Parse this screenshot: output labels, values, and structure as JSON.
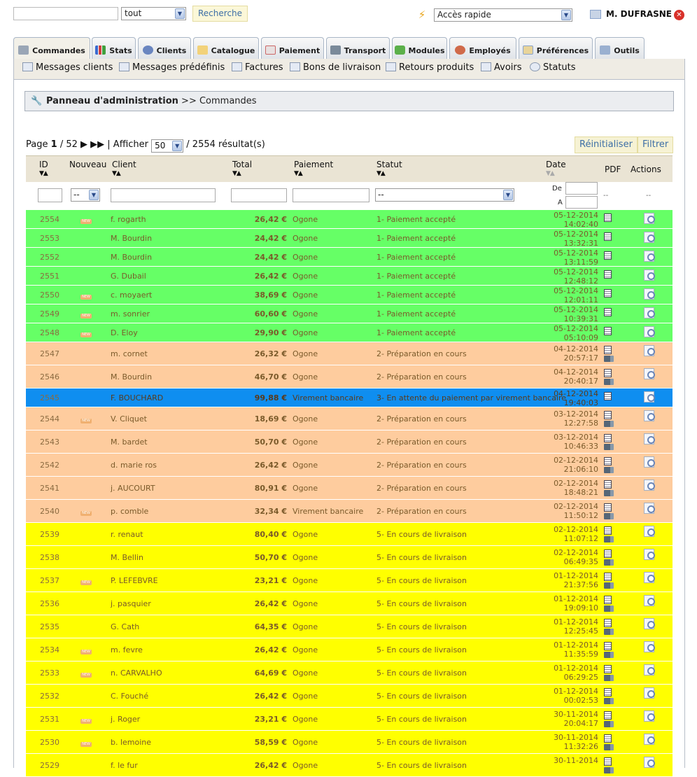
{
  "top": {
    "search_value": "",
    "scope_select": "tout",
    "search_button": "Recherche",
    "quick_access": "Accès rapide",
    "user_name": "M. DUFRASNE"
  },
  "tabs": [
    {
      "label": "Commandes",
      "icon": "cart-icon",
      "active": true
    },
    {
      "label": "Stats",
      "icon": "chart-icon"
    },
    {
      "label": "Clients",
      "icon": "user-icon"
    },
    {
      "label": "Catalogue",
      "icon": "folder-icon"
    },
    {
      "label": "Paiement",
      "icon": "payment-icon"
    },
    {
      "label": "Transport",
      "icon": "truck-icon"
    },
    {
      "label": "Modules",
      "icon": "puzzle-icon"
    },
    {
      "label": "Employés",
      "icon": "employee-icon"
    },
    {
      "label": "Préférences",
      "icon": "preferences-icon"
    },
    {
      "label": "Outils",
      "icon": "tools-icon"
    }
  ],
  "subtabs": [
    {
      "label": "Messages clients",
      "icon": "mail-icon"
    },
    {
      "label": "Messages prédéfinis",
      "icon": "message-icon"
    },
    {
      "label": "Factures",
      "icon": "invoice-icon"
    },
    {
      "label": "Bons de livraison",
      "icon": "delivery-icon"
    },
    {
      "label": "Retours produits",
      "icon": "return-icon"
    },
    {
      "label": "Avoirs",
      "icon": "credit-icon"
    },
    {
      "label": "Statuts",
      "icon": "status-icon"
    }
  ],
  "breadcrumb": {
    "root": "Panneau d'administration",
    "sep": ">>",
    "current": "Commandes"
  },
  "pager": {
    "page_label": "Page",
    "page": "1",
    "total_pages": "/ 52",
    "show_label": "| Afficher",
    "per_page": "50",
    "results": "/ 2554 résultat(s)"
  },
  "buttons": {
    "reset": "Réinitialiser",
    "filter": "Filtrer"
  },
  "headers": {
    "id": "ID",
    "new": "Nouveau",
    "client": "Client",
    "total": "Total",
    "payment": "Paiement",
    "status": "Statut",
    "date": "Date",
    "pdf": "PDF",
    "actions": "Actions"
  },
  "filters": {
    "new": "--",
    "status": "--",
    "date_from": "De",
    "date_to": "A",
    "pdf": "--",
    "actions": "--"
  },
  "colors": {
    "accepted": "#66ff66",
    "preparation": "#fecc9e",
    "transfer": "#0f8ef0",
    "delivery": "#ffff00"
  },
  "orders": [
    {
      "id": "2554",
      "new": true,
      "client": "f. rogarth",
      "total": "26,42 €",
      "payment": "Ogone",
      "status": "1- Paiement accepté",
      "date": "05-12-2014",
      "time": "14:02:40",
      "color": "g",
      "truck": false
    },
    {
      "id": "2553",
      "new": false,
      "client": "M. Bourdin",
      "total": "24,42 €",
      "payment": "Ogone",
      "status": "1- Paiement accepté",
      "date": "05-12-2014",
      "time": "13:32:31",
      "color": "g",
      "truck": false
    },
    {
      "id": "2552",
      "new": false,
      "client": "M. Bourdin",
      "total": "24,42 €",
      "payment": "Ogone",
      "status": "1- Paiement accepté",
      "date": "05-12-2014",
      "time": "13:11:59",
      "color": "g",
      "truck": false
    },
    {
      "id": "2551",
      "new": false,
      "client": "G. Dubail",
      "total": "26,42 €",
      "payment": "Ogone",
      "status": "1- Paiement accepté",
      "date": "05-12-2014",
      "time": "12:48:12",
      "color": "g",
      "truck": false
    },
    {
      "id": "2550",
      "new": true,
      "client": "c. moyaert",
      "total": "38,69 €",
      "payment": "Ogone",
      "status": "1- Paiement accepté",
      "date": "05-12-2014",
      "time": "12:01:11",
      "color": "g",
      "truck": false
    },
    {
      "id": "2549",
      "new": true,
      "client": "m. sonrier",
      "total": "60,60 €",
      "payment": "Ogone",
      "status": "1- Paiement accepté",
      "date": "05-12-2014",
      "time": "10:39:31",
      "color": "g",
      "truck": false
    },
    {
      "id": "2548",
      "new": true,
      "client": "D. Eloy",
      "total": "29,90 €",
      "payment": "Ogone",
      "status": "1- Paiement accepté",
      "date": "05-12-2014",
      "time": "05:10:09",
      "color": "g",
      "truck": false
    },
    {
      "id": "2547",
      "new": false,
      "client": "m. cornet",
      "total": "26,32 €",
      "payment": "Ogone",
      "status": "2- Préparation en cours",
      "date": "04-12-2014",
      "time": "20:57:17",
      "color": "o",
      "truck": true
    },
    {
      "id": "2546",
      "new": false,
      "client": "M. Bourdin",
      "total": "46,70 €",
      "payment": "Ogone",
      "status": "2- Préparation en cours",
      "date": "04-12-2014",
      "time": "20:40:17",
      "color": "o",
      "truck": true
    },
    {
      "id": "2545",
      "new": false,
      "client": "F. BOUCHARD",
      "total": "99,88 €",
      "payment": "Virement bancaire",
      "status": "3- En attente du paiement par virement bancaire",
      "date": "04-12-2014",
      "time": "19:40:03",
      "color": "b",
      "truck": false
    },
    {
      "id": "2544",
      "new": true,
      "client": "V. Cliquet",
      "total": "18,69 €",
      "payment": "Ogone",
      "status": "2- Préparation en cours",
      "date": "03-12-2014",
      "time": "12:27:58",
      "color": "o",
      "truck": true
    },
    {
      "id": "2543",
      "new": false,
      "client": "M. bardet",
      "total": "50,70 €",
      "payment": "Ogone",
      "status": "2- Préparation en cours",
      "date": "03-12-2014",
      "time": "10:46:33",
      "color": "o",
      "truck": true
    },
    {
      "id": "2542",
      "new": false,
      "client": "d. marie ros",
      "total": "26,42 €",
      "payment": "Ogone",
      "status": "2- Préparation en cours",
      "date": "02-12-2014",
      "time": "21:06:10",
      "color": "o",
      "truck": true
    },
    {
      "id": "2541",
      "new": false,
      "client": "j. AUCOURT",
      "total": "80,91 €",
      "payment": "Ogone",
      "status": "2- Préparation en cours",
      "date": "02-12-2014",
      "time": "18:48:21",
      "color": "o",
      "truck": true
    },
    {
      "id": "2540",
      "new": true,
      "client": "p. comble",
      "total": "32,34 €",
      "payment": "Virement bancaire",
      "status": "2- Préparation en cours",
      "date": "02-12-2014",
      "time": "11:50:12",
      "color": "o",
      "truck": true
    },
    {
      "id": "2539",
      "new": false,
      "client": "r. renaut",
      "total": "80,40 €",
      "payment": "Ogone",
      "status": "5- En cours de livraison",
      "date": "02-12-2014",
      "time": "11:07:12",
      "color": "y",
      "truck": true
    },
    {
      "id": "2538",
      "new": false,
      "client": "M. Bellin",
      "total": "50,70 €",
      "payment": "Ogone",
      "status": "5- En cours de livraison",
      "date": "02-12-2014",
      "time": "06:49:35",
      "color": "y",
      "truck": true
    },
    {
      "id": "2537",
      "new": true,
      "client": "P. LEFEBVRE",
      "total": "23,21 €",
      "payment": "Ogone",
      "status": "5- En cours de livraison",
      "date": "01-12-2014",
      "time": "21:37:56",
      "color": "y",
      "truck": true
    },
    {
      "id": "2536",
      "new": false,
      "client": "j. pasquier",
      "total": "26,42 €",
      "payment": "Ogone",
      "status": "5- En cours de livraison",
      "date": "01-12-2014",
      "time": "19:09:10",
      "color": "y",
      "truck": true
    },
    {
      "id": "2535",
      "new": false,
      "client": "G. Cath",
      "total": "64,35 €",
      "payment": "Ogone",
      "status": "5- En cours de livraison",
      "date": "01-12-2014",
      "time": "12:25:45",
      "color": "y",
      "truck": true
    },
    {
      "id": "2534",
      "new": true,
      "client": "m. fevre",
      "total": "26,42 €",
      "payment": "Ogone",
      "status": "5- En cours de livraison",
      "date": "01-12-2014",
      "time": "11:35:59",
      "color": "y",
      "truck": true
    },
    {
      "id": "2533",
      "new": true,
      "client": "n. CARVALHO",
      "total": "64,69 €",
      "payment": "Ogone",
      "status": "5- En cours de livraison",
      "date": "01-12-2014",
      "time": "06:29:25",
      "color": "y",
      "truck": true
    },
    {
      "id": "2532",
      "new": false,
      "client": "C. Fouché",
      "total": "26,42 €",
      "payment": "Ogone",
      "status": "5- En cours de livraison",
      "date": "01-12-2014",
      "time": "00:02:53",
      "color": "y",
      "truck": true
    },
    {
      "id": "2531",
      "new": true,
      "client": "j. Roger",
      "total": "23,21 €",
      "payment": "Ogone",
      "status": "5- En cours de livraison",
      "date": "30-11-2014",
      "time": "20:04:17",
      "color": "y",
      "truck": true
    },
    {
      "id": "2530",
      "new": true,
      "client": "b. lemoine",
      "total": "58,59 €",
      "payment": "Ogone",
      "status": "5- En cours de livraison",
      "date": "30-11-2014",
      "time": "11:32:26",
      "color": "y",
      "truck": true
    },
    {
      "id": "2529",
      "new": false,
      "client": "f. le fur",
      "total": "26,42 €",
      "payment": "Ogone",
      "status": "5- En cours de livraison",
      "date": "30-11-2014",
      "time": "",
      "color": "y",
      "truck": true
    }
  ]
}
